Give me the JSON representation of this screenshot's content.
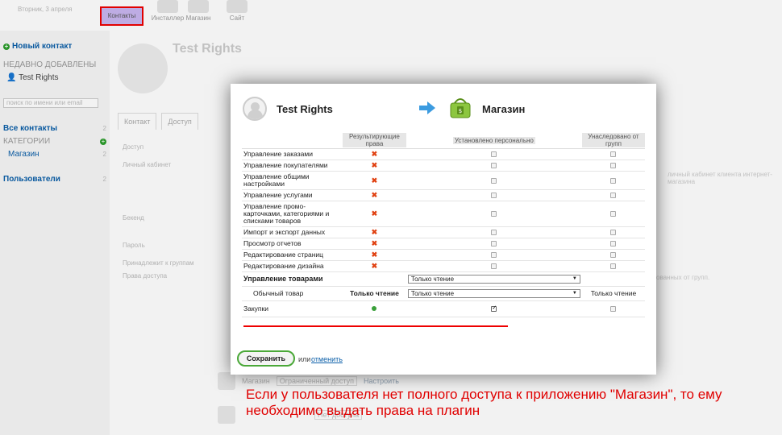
{
  "topbar": {
    "date": "Вторник, 3 апреля",
    "apps": [
      {
        "label": "Контакты",
        "active": true
      },
      {
        "label": "Инсталлер"
      },
      {
        "label": "Магазин"
      },
      {
        "label": "Сайт"
      }
    ]
  },
  "sidebar": {
    "new_contact": "Новый контакт",
    "recent_head": "НЕДАВНО ДОБАВЛЕНЫ",
    "recent_item": "Test Rights",
    "search_placeholder": "поиск по имени или email",
    "all_contacts": "Все контакты",
    "all_contacts_count": "2",
    "categories_head": "КАТЕГОРИИ",
    "category_shop": "Магазин",
    "category_shop_count": "2",
    "users": "Пользователи",
    "users_count": "2"
  },
  "contact": {
    "name": "Test Rights",
    "tabs": [
      "Контакт",
      "Доступ"
    ],
    "labels": [
      "Доступ",
      "Личный кабинет",
      "Бекенд",
      "Пароль",
      "Принадлежит к группам",
      "Права доступа"
    ],
    "right_hint_1": "личный кабинет клиента интернет-магазина",
    "right_hint_2": "ованных от групп.",
    "shop_access": "Ограниченный доступ",
    "shop_settings": "Настроить",
    "no_access": "Нет доступа"
  },
  "modal": {
    "user_name": "Test Rights",
    "app_name": "Магазин",
    "columns": {
      "resulting": "Результирующие права",
      "personal": "Установлено персонально",
      "inherited": "Унаследовано от групп"
    },
    "rows": [
      {
        "label": "Управление заказами",
        "result": "deny"
      },
      {
        "label": "Управление покупателями",
        "result": "deny"
      },
      {
        "label": "Управление общими настройками",
        "result": "deny"
      },
      {
        "label": "Управление услугами",
        "result": "deny"
      },
      {
        "label": "Управление промо-карточками, категориями и списками товаров",
        "result": "deny"
      },
      {
        "label": "Импорт и экспорт данных",
        "result": "deny"
      },
      {
        "label": "Просмотр отчетов",
        "result": "deny"
      },
      {
        "label": "Редактирование страниц",
        "result": "deny"
      },
      {
        "label": "Редактирование дизайна",
        "result": "deny"
      }
    ],
    "products_label": "Управление товарами",
    "products_select": "Только чтение",
    "regular_label": "Обычный товар",
    "regular_result": "Только чтение",
    "regular_select": "Только чтение",
    "regular_inherited": "Только чтение",
    "purchases_label": "Закупки",
    "save": "Сохранить",
    "or": "или",
    "cancel": "отменить"
  },
  "note": "Если у пользователя нет полного доступа к приложению \"Магазин\", то ему необходимо выдать права на плагин",
  "colors": {
    "annotation": "#e00000",
    "save_border": "#4aa838",
    "link": "#0a5ea8"
  }
}
